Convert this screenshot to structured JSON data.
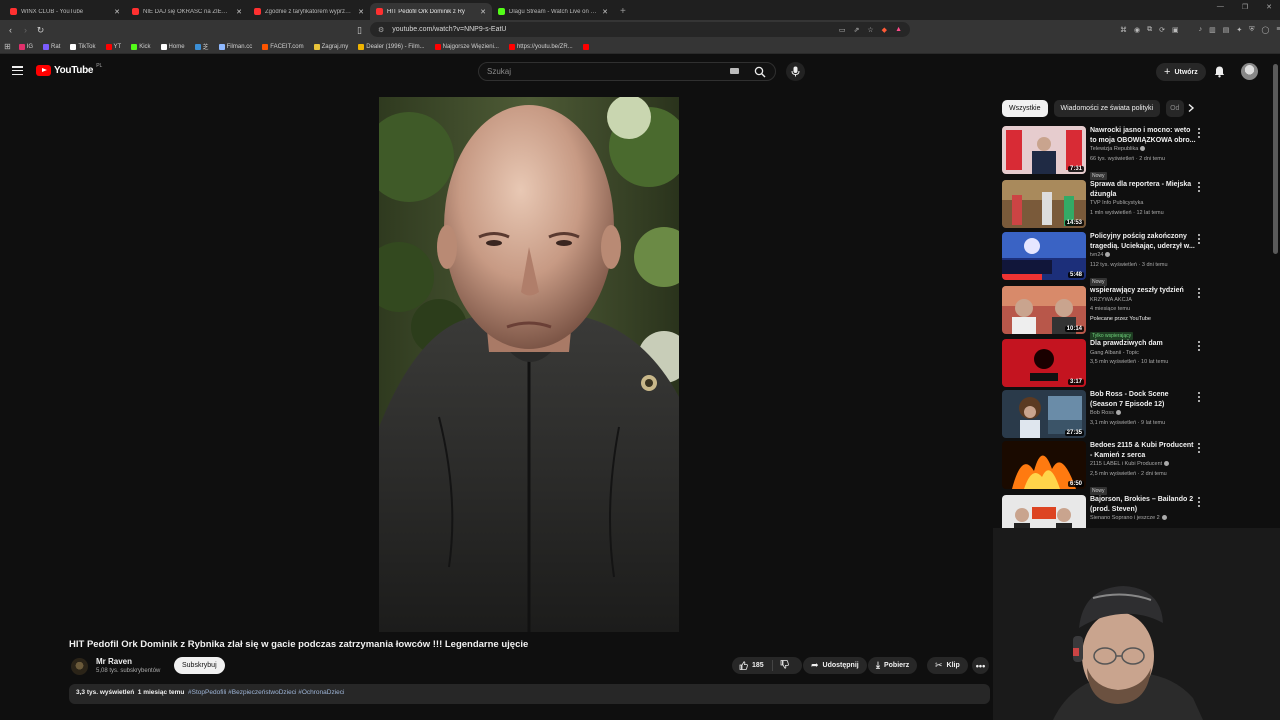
{
  "browser": {
    "tabs": [
      {
        "label": "WINX CLUB - YouTube",
        "color": "#ff3030"
      },
      {
        "label": "NIE DAJ się OKRAŚĆ na ZIEMNIAKACH",
        "color": "#ff3030"
      },
      {
        "label": "Zgodnie z taryfikatorem wyprzeda",
        "color": "#ff3030"
      },
      {
        "label": "HIT Pedofil Ork Dominik z Ry",
        "color": "#ff3030",
        "active": true
      },
      {
        "label": "Dlagu Stream - Watch Live on Kick",
        "color": "#53fc18"
      }
    ],
    "url": "youtube.com/watch?v=NNP9-s-EatU",
    "bookmarks": [
      {
        "label": "IG",
        "color": "#e1306c"
      },
      {
        "label": "Rat",
        "color": "#7b5cff"
      },
      {
        "label": "TikTok",
        "color": "#ffffff"
      },
      {
        "label": "YT",
        "color": "#ff0000"
      },
      {
        "label": "Kick",
        "color": "#53fc18"
      },
      {
        "label": "Home",
        "color": "#ffffff"
      },
      {
        "label": "芝",
        "color": "#3b8fd6"
      },
      {
        "label": "Filman.cc",
        "color": "#8fb9ff"
      },
      {
        "label": "FACEIT.com",
        "color": "#ff5500"
      },
      {
        "label": "Zagraj.my",
        "color": "#e8c33a"
      },
      {
        "label": "Dealer (1996) - Film...",
        "color": "#f0b400"
      },
      {
        "label": "Najgorsze Więzieni...",
        "color": "#ff0000"
      },
      {
        "label": "https://youtu.be/ZR...",
        "color": "#ff0000"
      },
      {
        "label": "",
        "color": "#ff0000"
      }
    ]
  },
  "header": {
    "logo_text": "YouTube",
    "logo_region": "PL",
    "search_placeholder": "Szukaj",
    "create_label": "Utwórz"
  },
  "video": {
    "title": "HIT Pedofil Ork Dominik z Rybnika zlał się w gacie podczas zatrzymania łowców !!! Legendarne ujęcie",
    "channel": "Mr Raven",
    "subscribers": "5,08 tys. subskrybentów",
    "subscribe_label": "Subskrybuj",
    "likes": "185",
    "share_label": "Udostępnij",
    "download_label": "Pobierz",
    "clip_label": "Klip",
    "views": "3,3 tys. wyświetleń",
    "age": "1 miesiąc temu",
    "tags": "#StopPedofili #BezpieczeństwoDzieci #OchronaDzieci"
  },
  "sidebar": {
    "chips": [
      "Wszystkie",
      "Wiadomości ze świata polityki",
      "Od"
    ],
    "recommendations": [
      {
        "title": "Nawrocki jasno i mocno: weto to moja OBOWIĄZKOWA obro...",
        "channel": "Telewizja Republika",
        "verified": true,
        "meta": "66 tys. wyświetleń · 2 dni temu",
        "badge": "Nowy",
        "duration": "7:31",
        "thumb": "flag"
      },
      {
        "title": "Sprawa dla reportera - Miejska dżungla",
        "channel": "TVP Info Publicystyka",
        "verified": false,
        "meta": "1 mln wyświetleń · 12 lat temu",
        "badge": "",
        "duration": "14:53",
        "thumb": "room"
      },
      {
        "title": "Policyjny pościg zakończony tragedią. Uciekając, uderzył w...",
        "channel": "tvn24",
        "verified": true,
        "meta": "112 tys. wyświetleń · 3 dni temu",
        "badge": "Nowy",
        "duration": "5:48",
        "thumb": "news"
      },
      {
        "title": "wspierawjący zeszły tydzień",
        "channel": "KRZYWA AKCJA",
        "verified": false,
        "meta": "4 miesiące temu",
        "badge": "Tylko wspierający",
        "badge_green": true,
        "extra": "Polecane przez YouTube",
        "duration": "10:14",
        "thumb": "podcast"
      },
      {
        "title": "Dla prawdziwych dam",
        "channel": "Gang Albanii - Topic",
        "verified": false,
        "meta": "3,5 mln wyświetleń · 10 lat temu",
        "badge": "",
        "duration": "3:17",
        "thumb": "red"
      },
      {
        "title": "Bob Ross - Dock Scene (Season 7 Episode 12)",
        "channel": "Bob Ross",
        "verified": true,
        "meta": "3,1 mln wyświetleń · 9 lat temu",
        "badge": "",
        "duration": "27:35",
        "thumb": "bob"
      },
      {
        "title": "Bedoes 2115 & Kubi Producent - Kamień z serca",
        "channel": "2115 LABEL i Kubi Producent",
        "verified": true,
        "meta": "2,5 mln wyświetleń · 2 dni temu",
        "badge": "Nowy",
        "duration": "6:50",
        "thumb": "fire"
      },
      {
        "title": "Bajorson, Brokies – Bailando 2 (prod. Steven)",
        "channel": "Sienano Soprano i jeszcze 2",
        "verified": true,
        "meta": "",
        "badge": "",
        "duration": "",
        "thumb": "bailando"
      }
    ]
  },
  "colors": {
    "brand": "#ff0000",
    "background": "#0f0f0f",
    "surface": "#272727"
  }
}
